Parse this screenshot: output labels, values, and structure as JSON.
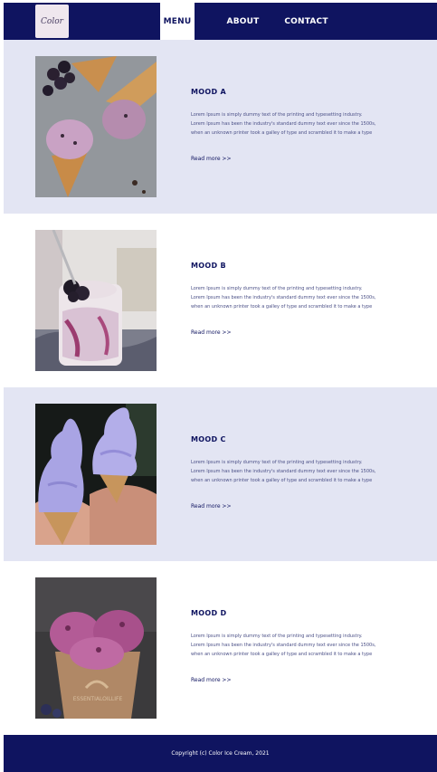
{
  "header": {
    "logo_text": "Color",
    "nav": [
      {
        "label": "MENU",
        "active": true
      },
      {
        "label": "ABOUT",
        "active": false
      },
      {
        "label": "CONTACT",
        "active": false
      }
    ]
  },
  "sections": [
    {
      "title": "MOOD A",
      "body_lines": [
        "Lorem Ipsum is simply dummy text of the printing and typesetting industry.",
        "Lorem Ipsum has been the industry's standard dummy text ever since the 1500s,",
        "when an unknown printer took a galley of type and scrambled it to make a type"
      ],
      "link": "Read more >>"
    },
    {
      "title": "MOOD B",
      "body_lines": [
        "Lorem Ipsum is simply dummy text of the printing and typesetting industry.",
        "Lorem Ipsum has been the industry's standard dummy text ever since the 1500s,",
        "when an unknown printer took a galley of type and scrambled it to make a type"
      ],
      "link": "Read more >>"
    },
    {
      "title": "MOOD C",
      "body_lines": [
        "Lorem Ipsum is simply dummy text of the printing and typesetting industry.",
        "Lorem Ipsum has been the industry's standard dummy text ever since the 1500s,",
        "when an unknown printer took a galley of type and scrambled it to make a type"
      ],
      "link": "Read more >>"
    },
    {
      "title": "MOOD D",
      "body_lines": [
        "Lorem Ipsum is simply dummy text of the printing and typesetting industry.",
        "Lorem Ipsum has been the industry's standard dummy text ever since the 1500s,",
        "when an unknown printer took a galley of type and scrambled it to make a type"
      ],
      "link": "Read more >>"
    }
  ],
  "photo_watermark": "ESSENTIALOILLIFE",
  "footer": {
    "copyright": "Copyright (c) Color Ice Cream, 2021"
  },
  "colors": {
    "navy": "#0f1460",
    "lavender_bg": "#e3e5f3",
    "body_text": "#4a4f86"
  }
}
